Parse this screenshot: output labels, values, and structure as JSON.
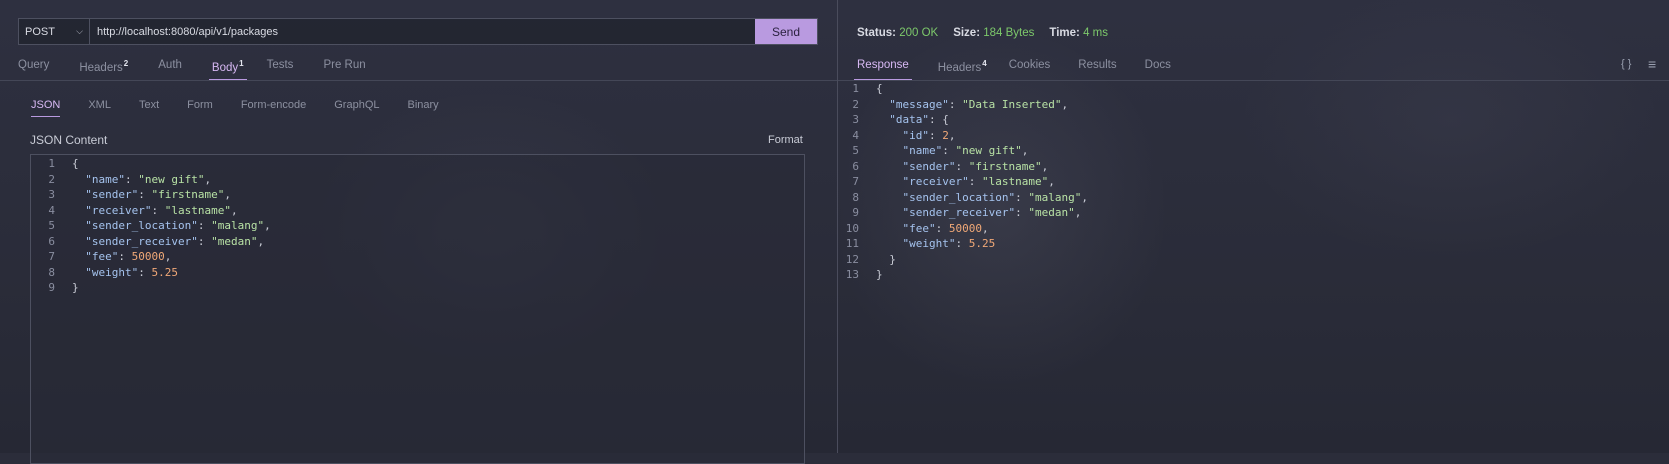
{
  "request": {
    "method": "POST",
    "url": "http://localhost:8080/api/v1/packages",
    "send_label": "Send",
    "tabs": [
      {
        "label": "Query",
        "badge": ""
      },
      {
        "label": "Headers",
        "badge": "2"
      },
      {
        "label": "Auth",
        "badge": ""
      },
      {
        "label": "Body",
        "badge": "1"
      },
      {
        "label": "Tests",
        "badge": ""
      },
      {
        "label": "Pre Run",
        "badge": ""
      }
    ],
    "body_tabs": [
      "JSON",
      "XML",
      "Text",
      "Form",
      "Form-encode",
      "GraphQL",
      "Binary"
    ],
    "json_content_label": "JSON Content",
    "format_label": "Format",
    "body_lines": [
      "{",
      "  \"name\": \"new gift\",",
      "  \"sender\": \"firstname\",",
      "  \"receiver\": \"lastname\",",
      "  \"sender_location\": \"malang\",",
      "  \"sender_receiver\": \"medan\",",
      "  \"fee\": 50000,",
      "  \"weight\": 5.25",
      "}"
    ]
  },
  "response": {
    "status_label": "Status:",
    "status_value": "200 OK",
    "size_label": "Size:",
    "size_value": "184 Bytes",
    "time_label": "Time:",
    "time_value": "4 ms",
    "tabs": [
      {
        "label": "Response",
        "badge": ""
      },
      {
        "label": "Headers",
        "badge": "4"
      },
      {
        "label": "Cookies",
        "badge": ""
      },
      {
        "label": "Results",
        "badge": ""
      },
      {
        "label": "Docs",
        "badge": ""
      }
    ],
    "braces_icon_glyph": "{ }",
    "wrap_icon_glyph": "≡",
    "body_lines": [
      "{",
      "  \"message\": \"Data Inserted\",",
      "  \"data\": {",
      "    \"id\": 2,",
      "    \"name\": \"new gift\",",
      "    \"sender\": \"firstname\",",
      "    \"receiver\": \"lastname\",",
      "    \"sender_location\": \"malang\",",
      "    \"sender_receiver\": \"medan\",",
      "    \"fee\": 50000,",
      "    \"weight\": 5.25",
      "  }",
      "}"
    ]
  },
  "colors": {
    "accent": "#b99ae0",
    "status_ok": "#7dc96b",
    "json_key": "#a5c3ee",
    "json_string": "#b8e2a5",
    "json_number": "#f0a877"
  }
}
